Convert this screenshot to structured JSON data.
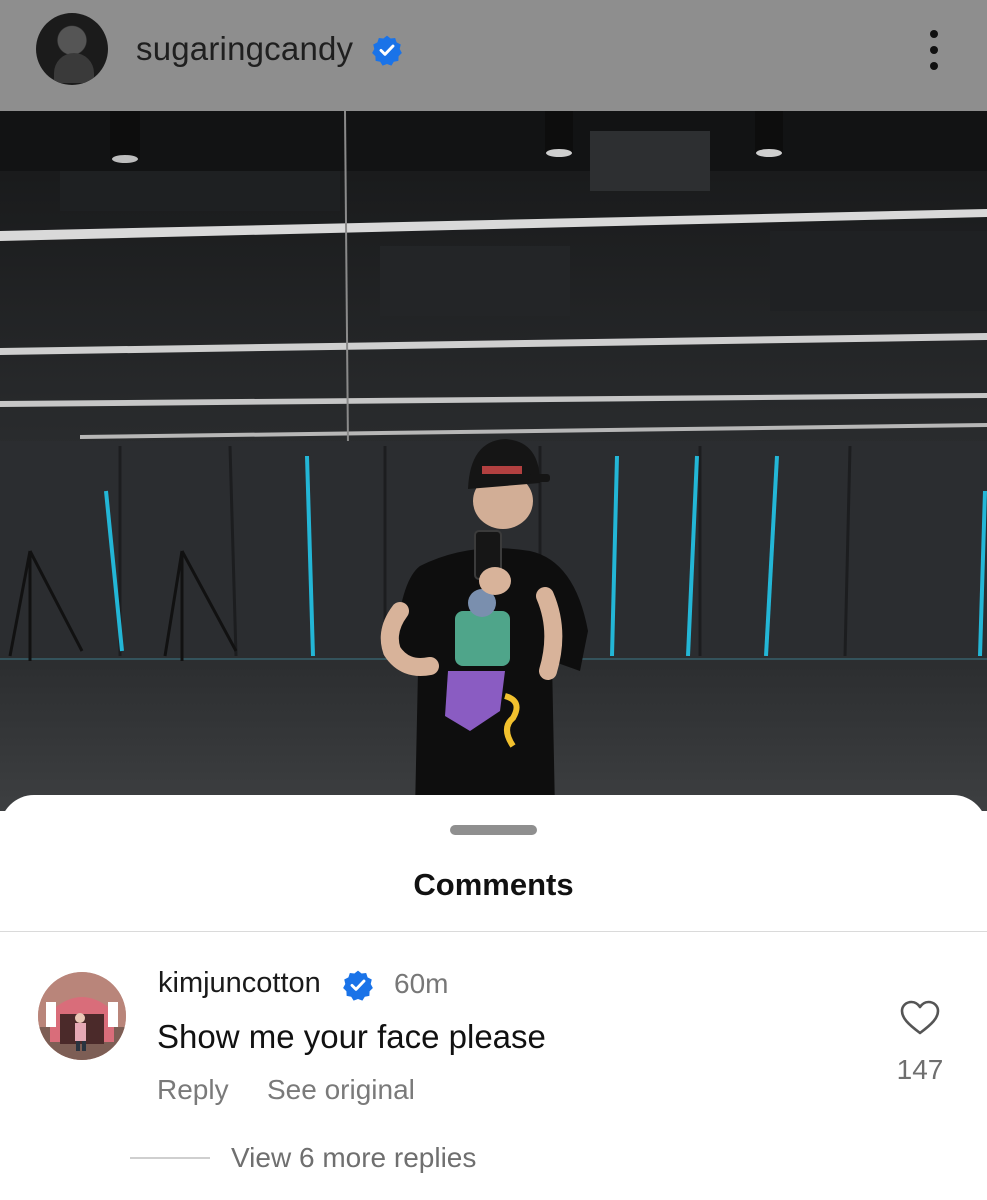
{
  "post": {
    "username": "sugaringcandy",
    "verified": true
  },
  "comments_sheet": {
    "title": "Comments",
    "comment": {
      "username": "kimjuncotton",
      "verified": true,
      "time": "60m",
      "text": "Show me your face please",
      "reply_label": "Reply",
      "see_original_label": "See original",
      "like_count": "147",
      "view_replies_label": "View 6 more replies"
    }
  },
  "colors": {
    "verified_blue": "#1a73e8",
    "header_gray": "#8e8e8e",
    "sheet_bg": "#ffffff"
  },
  "icons": [
    "more-options-icon",
    "verified-badge-icon",
    "heart-icon"
  ]
}
